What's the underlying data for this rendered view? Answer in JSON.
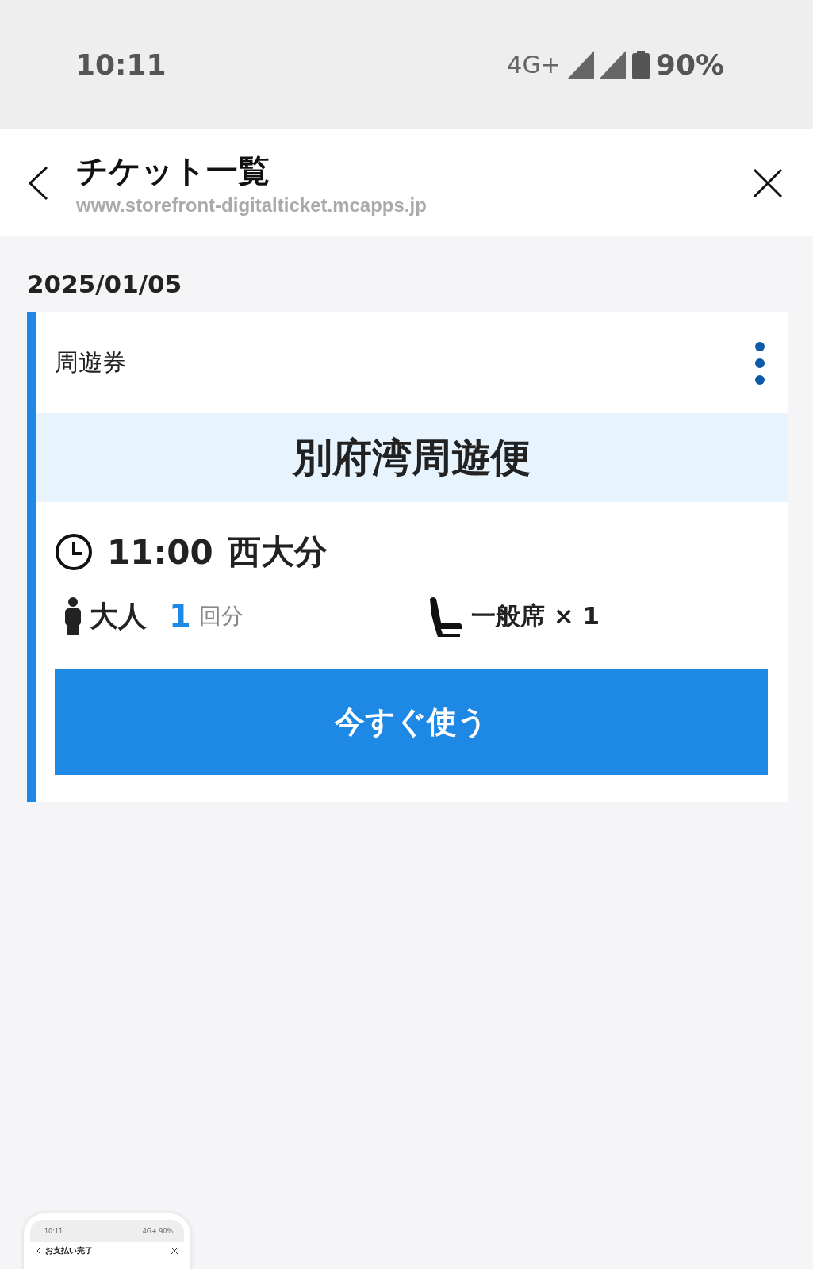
{
  "status_bar": {
    "time": "10:11",
    "network": "4G+",
    "battery": "90%"
  },
  "header": {
    "title": "チケット一覧",
    "url": "www.storefront-digitalticket.mcapps.jp"
  },
  "date": "2025/01/05",
  "ticket": {
    "type": "周遊券",
    "name": "別府湾周遊便",
    "time": "11:00",
    "departure": "西大分",
    "passenger": "大人",
    "count": "1",
    "count_unit": "回分",
    "seat": "一般席 × 1",
    "button": "今すぐ使う"
  },
  "screenshot_preview": {
    "time": "10:11",
    "network": "4G+",
    "battery": "90%",
    "title": "お支払い完了"
  }
}
